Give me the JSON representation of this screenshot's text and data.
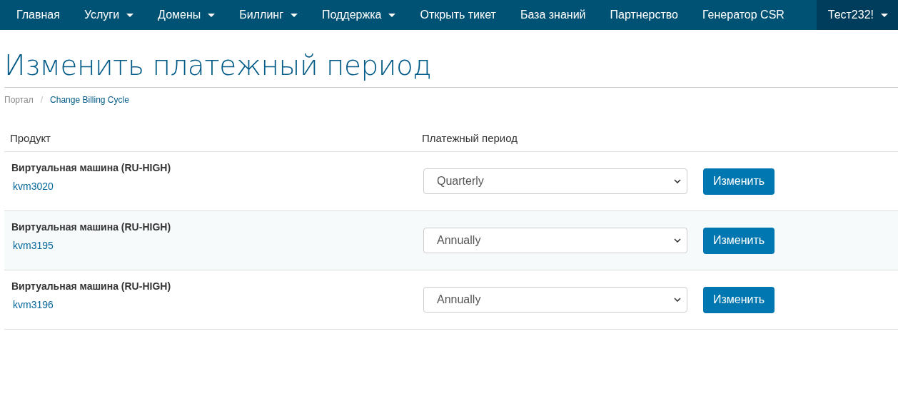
{
  "nav": [
    {
      "label": "Главная",
      "dropdown": false,
      "highlighted": false
    },
    {
      "label": "Услуги",
      "dropdown": true,
      "highlighted": false
    },
    {
      "label": "Домены",
      "dropdown": true,
      "highlighted": false
    },
    {
      "label": "Биллинг",
      "dropdown": true,
      "highlighted": false
    },
    {
      "label": "Поддержка",
      "dropdown": true,
      "highlighted": false
    },
    {
      "label": "Открыть тикет",
      "dropdown": false,
      "highlighted": false
    },
    {
      "label": "База знаний",
      "dropdown": false,
      "highlighted": false
    },
    {
      "label": "Партнерство",
      "dropdown": false,
      "highlighted": false
    },
    {
      "label": "Генератор CSR",
      "dropdown": false,
      "highlighted": false
    },
    {
      "label": "Тест232!",
      "dropdown": true,
      "highlighted": true
    }
  ],
  "page_title": "Изменить платежный период",
  "breadcrumb": [
    {
      "label": "Портал",
      "current": false
    },
    {
      "label": "Change Billing Cycle",
      "current": true
    }
  ],
  "breadcrumb_separator": "/",
  "table": {
    "columns": [
      "Продукт",
      "Платежный период"
    ],
    "rows": [
      {
        "product": "Виртуальная машина (RU-HIGH)",
        "service": "kvm3020",
        "cycle": "Quarterly",
        "button": "Изменить"
      },
      {
        "product": "Виртуальная машина (RU-HIGH)",
        "service": "kvm3195",
        "cycle": "Annually",
        "button": "Изменить"
      },
      {
        "product": "Виртуальная машина (RU-HIGH)",
        "service": "kvm3196",
        "cycle": "Annually",
        "button": "Изменить"
      }
    ]
  }
}
